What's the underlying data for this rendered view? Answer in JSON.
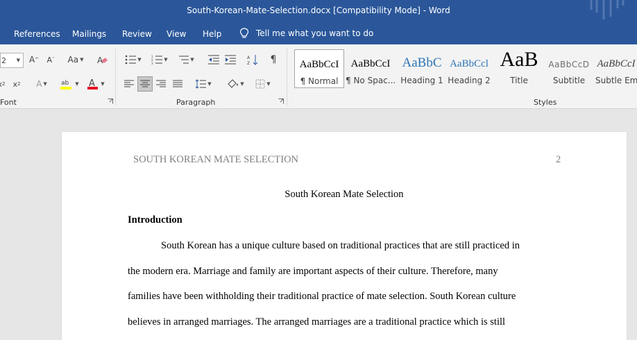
{
  "window": {
    "title": "South-Korean-Mate-Selection.docx [Compatibility Mode]  -  Word"
  },
  "tabs": [
    {
      "label": "References"
    },
    {
      "label": "Mailings"
    },
    {
      "label": "Review"
    },
    {
      "label": "View"
    },
    {
      "label": "Help"
    }
  ],
  "tell_me": {
    "placeholder": "Tell me what you want to do"
  },
  "ribbon": {
    "font_group": {
      "label": "Font",
      "size_value": "2",
      "change_case_label": "Aa"
    },
    "paragraph_group": {
      "label": "Paragraph"
    },
    "styles_group": {
      "label": "Styles",
      "styles": [
        {
          "preview": "AaBbCcI",
          "name": "¶ Normal",
          "selected": true
        },
        {
          "preview": "AaBbCcI",
          "name": "¶ No Spac..."
        },
        {
          "preview": "AaBbC",
          "name": "Heading 1"
        },
        {
          "preview": "AaBbCcl",
          "name": "Heading 2"
        },
        {
          "preview": "AaB",
          "name": "Title"
        },
        {
          "preview": "AaBbCcD",
          "name": "Subtitle"
        },
        {
          "preview": "AaBbCcI",
          "name": "Subtle Em..."
        }
      ]
    }
  },
  "document": {
    "header_text": "SOUTH KOREAN MATE SELECTION",
    "page_number": "2",
    "title": "South Korean Mate Selection",
    "heading": "Introduction",
    "lines": [
      "South Korean has a unique culture based on traditional practices that are still practiced in",
      "the modern era. Marriage and family are important aspects of their culture. Therefore, many",
      "families have been withholding their traditional practice of mate selection. South Korean culture",
      "believes in arranged marriages. The arranged marriages are a traditional practice which is still"
    ]
  },
  "colors": {
    "accent": "#2b579a",
    "ribbon": "#f3f3f3",
    "canvas": "#e6e6e6"
  }
}
